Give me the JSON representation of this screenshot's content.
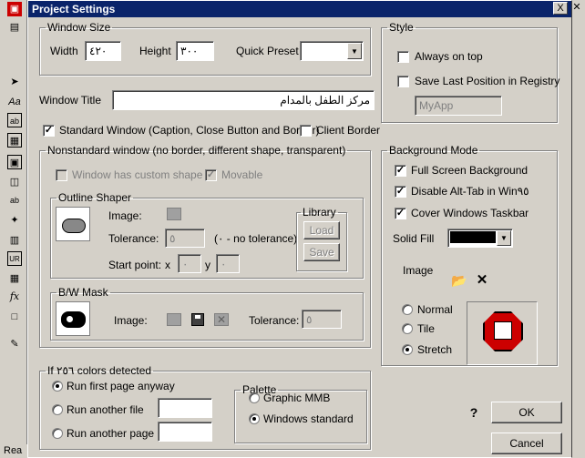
{
  "dialog": {
    "title": "Project Settings",
    "close_glyph": "X"
  },
  "background_app": {
    "status_text": "Rea",
    "tools": [
      "Aa",
      "ab",
      "ab",
      "fx"
    ]
  },
  "window_size": {
    "legend": "Window Size",
    "width_label": "Width",
    "width_value": "٤٢٠",
    "height_label": "Height",
    "height_value": "٣٠٠",
    "preset_label": "Quick Preset",
    "preset_value": ""
  },
  "window_title": {
    "label": "Window Title",
    "value": "مركز الطفل بالمدام"
  },
  "standard_window": {
    "label": "Standard Window (Caption, Close Button and Border)",
    "checked": true
  },
  "client_border": {
    "label": "Client Border",
    "checked": false
  },
  "nonstandard": {
    "legend": "Nonstandard window (no border, different shape, transparent)",
    "custom_shape_label": "Window has custom shape",
    "movable_label": "Movable",
    "outline": {
      "legend": "Outline Shaper",
      "image_label": "Image:",
      "tolerance_label": "Tolerance:",
      "tolerance_value": "٥",
      "tolerance_hint": "(٠ - no tolerance)",
      "start_label": "Start point:",
      "x_label": "x",
      "x_value": "٠",
      "y_label": "y",
      "y_value": "٠",
      "library_legend": "Library",
      "load_label": "Load",
      "save_label": "Save"
    },
    "bw": {
      "legend": "B/W Mask",
      "image_label": "Image:",
      "tolerance_label": "Tolerance:",
      "tolerance_value": "٥"
    }
  },
  "colors": {
    "legend": "If ٢٥٦ colors detected",
    "run_first": "Run first page anyway",
    "run_file": "Run another file",
    "run_page": "Run another page",
    "palette_legend": "Palette",
    "graphic_mmb": "Graphic MMB",
    "windows_standard": "Windows standard"
  },
  "style": {
    "legend": "Style",
    "always_on_top": "Always on top",
    "save_last_pos": "Save Last Position in Registry",
    "app_name_value": "MyApp"
  },
  "background_mode": {
    "legend": "Background Mode",
    "full_screen": "Full Screen Background",
    "disable_alt_tab": "Disable Alt-Tab in Win٩٥",
    "cover_taskbar": "Cover Windows Taskbar",
    "solid_fill_label": "Solid Fill",
    "solid_fill_color": "#000000",
    "image_label": "Image",
    "normal": "Normal",
    "tile": "Tile",
    "stretch": "Stretch"
  },
  "buttons": {
    "help_glyph": "?",
    "ok": "OK",
    "cancel": "Cancel"
  },
  "colors_accent": {
    "titlebar": "#0a246a",
    "preview_red": "#cc0000"
  }
}
